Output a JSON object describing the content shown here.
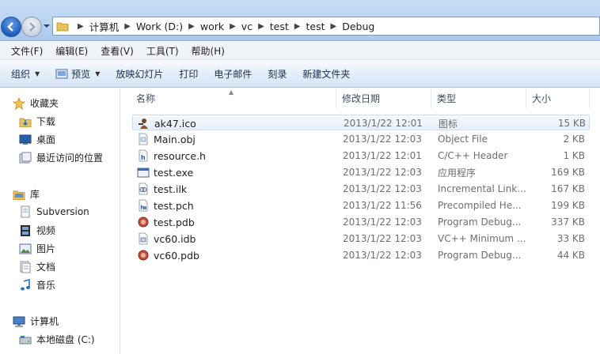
{
  "address": {
    "crumbs": [
      "计算机",
      "Work (D:)",
      "work",
      "vc",
      "test",
      "test",
      "Debug"
    ]
  },
  "menu": [
    "文件(F)",
    "编辑(E)",
    "查看(V)",
    "工具(T)",
    "帮助(H)"
  ],
  "toolbar": {
    "organize": "组织",
    "preview": "预览",
    "slideshow": "放映幻灯片",
    "print": "打印",
    "email": "电子邮件",
    "burn": "刻录",
    "new_folder": "新建文件夹"
  },
  "sidebar": {
    "favorites": "收藏夹",
    "fav_items": [
      "下载",
      "桌面",
      "最近访问的位置"
    ],
    "libraries": "库",
    "lib_items": [
      "Subversion",
      "视频",
      "图片",
      "文档",
      "音乐"
    ],
    "computer": "计算机",
    "drive": "本地磁盘 (C:)"
  },
  "columns": {
    "name": "名称",
    "modified": "修改日期",
    "type": "类型",
    "size": "大小"
  },
  "files": [
    {
      "name": "ak47.ico",
      "modified": "2013/1/22 12:01",
      "type": "图标",
      "size": "15 KB",
      "icon": "ico-icon"
    },
    {
      "name": "Main.obj",
      "modified": "2013/1/22 12:03",
      "type": "Object File",
      "size": "2 KB",
      "icon": "obj-file-icon"
    },
    {
      "name": "resource.h",
      "modified": "2013/1/22 12:01",
      "type": "C/C++ Header",
      "size": "1 KB",
      "icon": "header-file-icon"
    },
    {
      "name": "test.exe",
      "modified": "2013/1/22 12:03",
      "type": "应用程序",
      "size": "169 KB",
      "icon": "exe-file-icon"
    },
    {
      "name": "test.ilk",
      "modified": "2013/1/22 12:03",
      "type": "Incremental Link...",
      "size": "167 KB",
      "icon": "ilk-file-icon"
    },
    {
      "name": "test.pch",
      "modified": "2013/1/22 11:56",
      "type": "Precompiled He...",
      "size": "199 KB",
      "icon": "pch-file-icon"
    },
    {
      "name": "test.pdb",
      "modified": "2013/1/22 12:03",
      "type": "Program Debug...",
      "size": "337 KB",
      "icon": "pdb-file-icon"
    },
    {
      "name": "vc60.idb",
      "modified": "2013/1/22 12:03",
      "type": "VC++ Minimum ...",
      "size": "33 KB",
      "icon": "idb-file-icon"
    },
    {
      "name": "vc60.pdb",
      "modified": "2013/1/22 12:03",
      "type": "Program Debug...",
      "size": "44 KB",
      "icon": "pdb-file-icon"
    }
  ],
  "colors": {
    "accent": "#1d5bb8",
    "toolbar_text": "#1e2d4a",
    "meta_text": "#6d6d6d"
  }
}
